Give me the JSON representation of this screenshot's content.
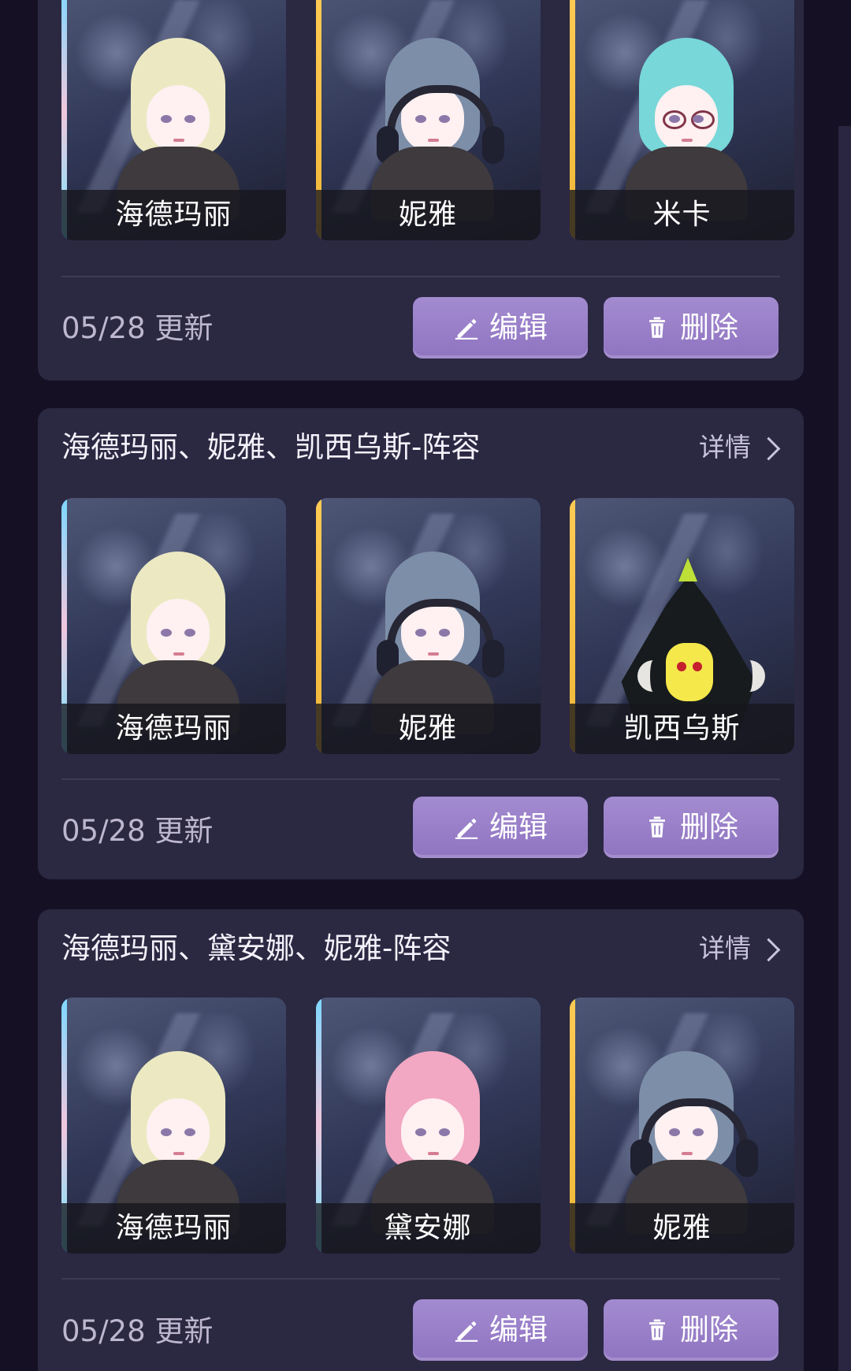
{
  "details_label": "详情",
  "update_text": "05/28 更新",
  "buttons": {
    "edit": "编辑",
    "delete": "删除"
  },
  "cards": [
    {
      "title": "",
      "characters": [
        {
          "name": "海德玛丽",
          "rarity": "cyan",
          "style": "pale"
        },
        {
          "name": "妮雅",
          "rarity": "gold",
          "style": "headphones"
        },
        {
          "name": "米卡",
          "rarity": "gold",
          "style": "glasses"
        }
      ]
    },
    {
      "title": "海德玛丽、妮雅、凯西乌斯-阵容",
      "characters": [
        {
          "name": "海德玛丽",
          "rarity": "cyan",
          "style": "pale"
        },
        {
          "name": "妮雅",
          "rarity": "gold",
          "style": "headphones"
        },
        {
          "name": "凯西乌斯",
          "rarity": "gold",
          "style": "monster"
        }
      ]
    },
    {
      "title": "海德玛丽、黛安娜、妮雅-阵容",
      "characters": [
        {
          "name": "海德玛丽",
          "rarity": "cyan",
          "style": "pale"
        },
        {
          "name": "黛安娜",
          "rarity": "cyan",
          "style": "pink"
        },
        {
          "name": "妮雅",
          "rarity": "gold",
          "style": "headphones"
        }
      ]
    }
  ],
  "colors": {
    "background": "#151024",
    "card": "#2b2842",
    "button": "#9b84ca",
    "gold": "#f0b738",
    "cyan": "#7dd8ff"
  },
  "icons": {
    "edit": "pencil-icon",
    "delete": "trash-icon",
    "details": "chevron-right-icon"
  }
}
